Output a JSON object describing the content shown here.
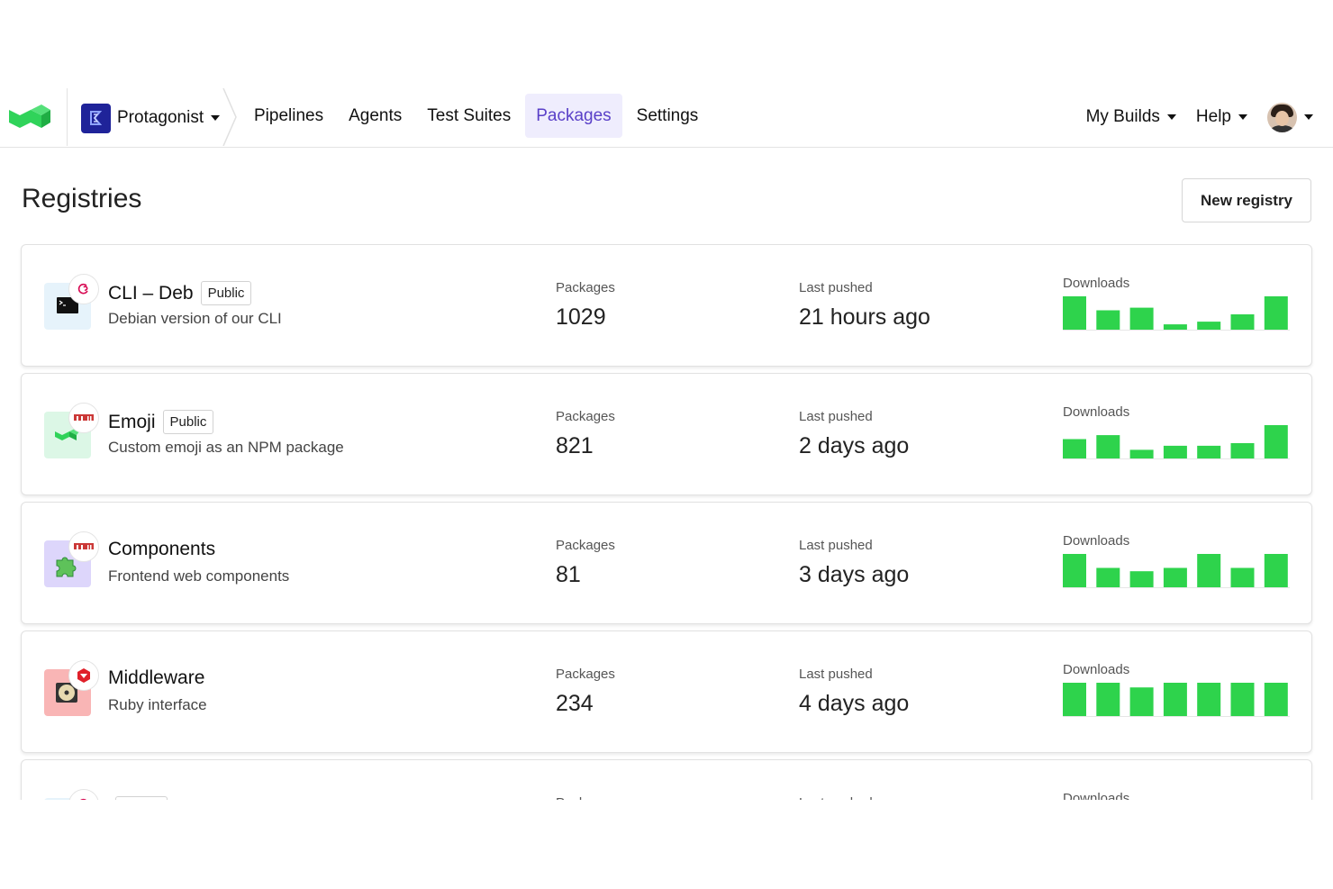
{
  "nav": {
    "org_name": "Protagonist",
    "links": [
      {
        "label": "Pipelines",
        "active": false
      },
      {
        "label": "Agents",
        "active": false
      },
      {
        "label": "Test Suites",
        "active": false
      },
      {
        "label": "Packages",
        "active": true
      },
      {
        "label": "Settings",
        "active": false
      }
    ],
    "my_builds": "My Builds",
    "help": "Help"
  },
  "header": {
    "title": "Registries",
    "new_button": "New registry"
  },
  "labels": {
    "packages": "Packages",
    "last_pushed": "Last pushed",
    "downloads": "Downloads"
  },
  "registries": [
    {
      "name": "CLI – Deb",
      "badge": "Public",
      "description": "Debian version of our CLI",
      "packages": "1029",
      "last_pushed": "21 hours ago",
      "icon": "terminal-icon",
      "ecosystem_icon": "debian-icon",
      "icon_bg": "#e6f3fb",
      "downloads": [
        1.0,
        0.58,
        0.66,
        0.16,
        0.24,
        0.46,
        1.0
      ]
    },
    {
      "name": "Emoji",
      "badge": "Public",
      "description": "Custom emoji as an NPM package",
      "packages": "821",
      "last_pushed": "2 days ago",
      "icon": "buildkite-icon",
      "ecosystem_icon": "npm-icon",
      "icon_bg": "#dcf7e6",
      "downloads": [
        0.58,
        0.7,
        0.26,
        0.38,
        0.38,
        0.46,
        1.0
      ]
    },
    {
      "name": "Components",
      "badge": "",
      "description": "Frontend web components",
      "packages": "81",
      "last_pushed": "3 days ago",
      "icon": "puzzle-icon",
      "ecosystem_icon": "npm-icon",
      "icon_bg": "#ddd6fb",
      "downloads": [
        1.0,
        0.58,
        0.48,
        0.58,
        1.0,
        0.58,
        1.0
      ]
    },
    {
      "name": "Middleware",
      "badge": "",
      "description": "Ruby interface",
      "packages": "234",
      "last_pushed": "4 days ago",
      "icon": "cd-icon",
      "ecosystem_icon": "ruby-gem-icon",
      "icon_bg": "#f9b5b5",
      "downloads": [
        1.0,
        1.0,
        0.86,
        1.0,
        1.0,
        1.0,
        1.0
      ]
    },
    {
      "name": "",
      "badge": "",
      "description": "",
      "packages": "",
      "last_pushed": "",
      "icon": "",
      "ecosystem_icon": "debian-icon",
      "icon_bg": "#e6f3fb",
      "downloads": []
    }
  ],
  "colors": {
    "accent": "#5a40c8",
    "accent_bg": "#efedfd",
    "bar": "#2ed34c",
    "org_badge": "#1f2399"
  }
}
